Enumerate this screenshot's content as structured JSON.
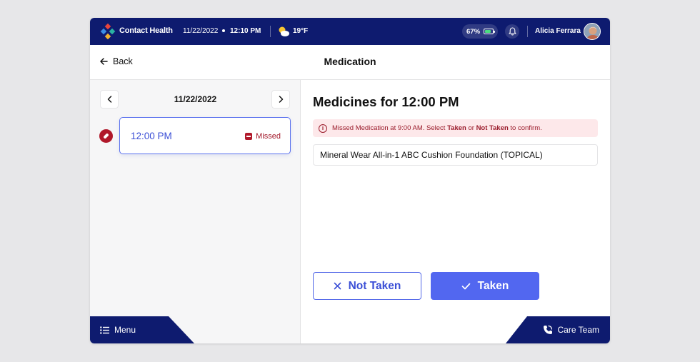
{
  "topbar": {
    "brand": "Contact Health",
    "date": "11/22/2022",
    "time": "12:10 PM",
    "temperature": "19°F",
    "weather_icon": "partly-sunny-icon",
    "battery": "67%",
    "user_name": "Alicia Ferrara"
  },
  "header": {
    "back_label": "Back",
    "title": "Medication"
  },
  "schedule": {
    "date": "11/22/2022",
    "slots": [
      {
        "time": "12:00 PM",
        "status": "Missed"
      }
    ]
  },
  "main": {
    "title": "Medicines for 12:00 PM",
    "alert": {
      "prefix": "Missed Medication at 9:00 AM. Select ",
      "taken": "Taken",
      "middle": " or ",
      "not_taken": "Not Taken",
      "suffix": " to confirm."
    },
    "medicines": [
      "Mineral Wear All-in-1 ABC Cushion Foundation (TOPICAL)"
    ],
    "not_taken_label": "Not Taken",
    "taken_label": "Taken"
  },
  "footer": {
    "menu_label": "Menu",
    "care_team_label": "Care Team"
  },
  "colors": {
    "navy": "#0e1b6f",
    "accent": "#5267f0",
    "missed_red": "#b0182a",
    "alert_bg": "#fde8ea"
  }
}
